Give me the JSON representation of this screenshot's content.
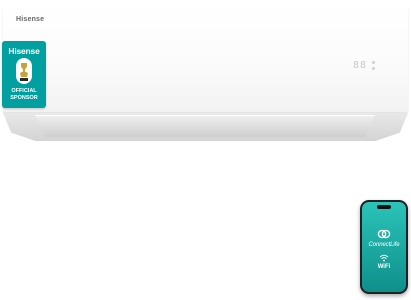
{
  "product": {
    "brand": "Hisense",
    "display_text": "88"
  },
  "sponsor_badge": {
    "brand": "Hisense",
    "line1": "OFFICIAL",
    "line2": "SPONSOR",
    "color": "#00a0a0"
  },
  "phone": {
    "app_name": "ConnectLife",
    "wifi_label": "WiFi",
    "app_icon": "connectlife-logo-icon",
    "wifi_icon": "wifi-icon",
    "screen_color": "#1aa79f"
  }
}
